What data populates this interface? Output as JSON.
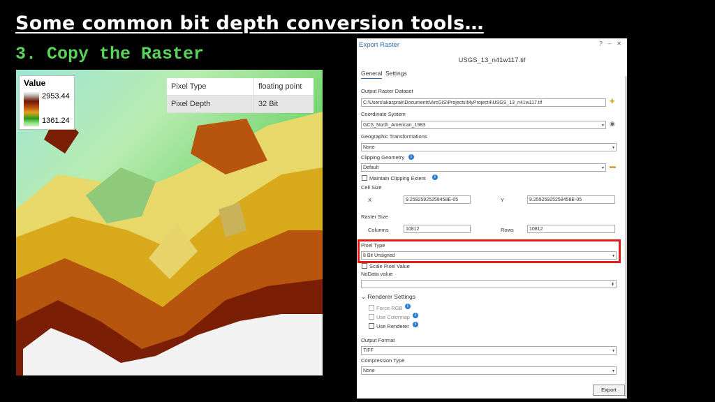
{
  "slide": {
    "title": "Some common bit depth conversion tools…",
    "subtitle": "3. Copy the Raster"
  },
  "legend": {
    "title": "Value",
    "high": "2953.44",
    "low": "1361.24"
  },
  "properties": [
    {
      "key": "Pixel Type",
      "value": "floating point"
    },
    {
      "key": "Pixel Depth",
      "value": "32 Bit"
    }
  ],
  "dialog": {
    "title": "Export Raster",
    "help": "?",
    "minimize": "–",
    "close": "✕",
    "file_name": "USGS_13_n41w117.tif",
    "tabs": [
      "General",
      "Settings"
    ],
    "output_raster_label": "Output Raster Dataset",
    "output_raster_value": "C:\\Users\\akasprak\\Documents\\ArcGIS\\Projects\\MyProject4\\USGS_13_n41w117.tif",
    "coord_label": "Coordinate System",
    "coord_value": "GCS_North_American_1983",
    "geo_label": "Geographic Transformations",
    "geo_value": "None",
    "clip_label": "Clipping Geometry",
    "clip_value": "Default",
    "maintain_clip_label": "Maintain Clipping Extent",
    "cell_size_label": "Cell Size",
    "x_label": "X",
    "x_value": "9.25925925258458E-05",
    "y_label": "Y",
    "y_value": "9.25925925258458E-05",
    "raster_size_label": "Raster Size",
    "columns_label": "Columns",
    "columns_value": "10812",
    "rows_label": "Rows",
    "rows_value": "10812",
    "pixel_type_label": "Pixel Type",
    "pixel_type_value": "8 Bit Unsigned",
    "scale_pixel_label": "Scale Pixel Value",
    "nodata_label": "NoData value",
    "nodata_value": "",
    "renderer_label": "Renderer Settings",
    "force_rgb_label": "Force RGB",
    "use_colormap_label": "Use Colormap",
    "use_renderer_label": "Use Renderer",
    "output_format_label": "Output Format",
    "output_format_value": "TIFF",
    "compression_label": "Compression Type",
    "compression_value": "None",
    "export_label": "Export"
  }
}
